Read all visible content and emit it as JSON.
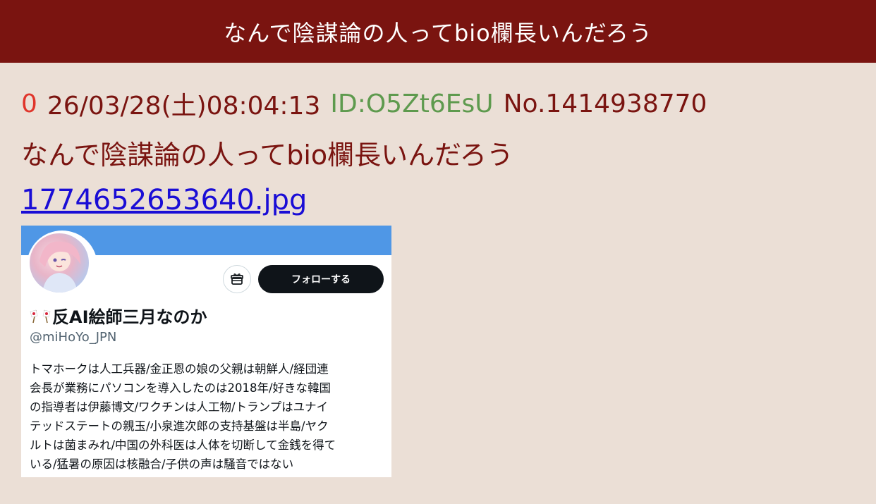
{
  "thread": {
    "title": "なんで陰謀論の人ってbio欄長いんだろう"
  },
  "post": {
    "number": "0",
    "datetime": "26/03/28(土)08:04:13",
    "id": "ID:O5Zt6EsU",
    "post_no": "No.1414938770",
    "body": "なんで陰謀論の人ってbio欄長いんだろう",
    "file_link": "1774652653640.jpg"
  },
  "profile_card": {
    "display_name": "反AI絵師三月なのか",
    "handle": "@miHoYo_JPN",
    "follow_button": "フォローする",
    "bio": "トマホークは人工兵器/金正恩の娘の父親は朝鮮人/経団連\n会長が業務にパソコンを導入したのは2018年/好きな韓国\nの指導者は伊藤博文/ワクチンは人工物/トランプはユナイ\nテッドステートの親玉/小泉進次郎の支持基盤は半島/ヤク\nルトは菌まみれ/中国の外科医は人体を切断して金銭を得て\nいる/猛暑の原因は核融合/子供の声は騒音ではない",
    "icons": [
      "flag-icon",
      "gift-icon",
      "avatar"
    ],
    "colors": {
      "banner": "#4f97e6",
      "follow_bg": "#0f1419"
    }
  },
  "colors": {
    "title_bar": "#7a1410",
    "background": "#ebdfd6",
    "post_number": "#e0352b",
    "post_id": "#5e9a4e",
    "link": "#1a0dd6"
  }
}
